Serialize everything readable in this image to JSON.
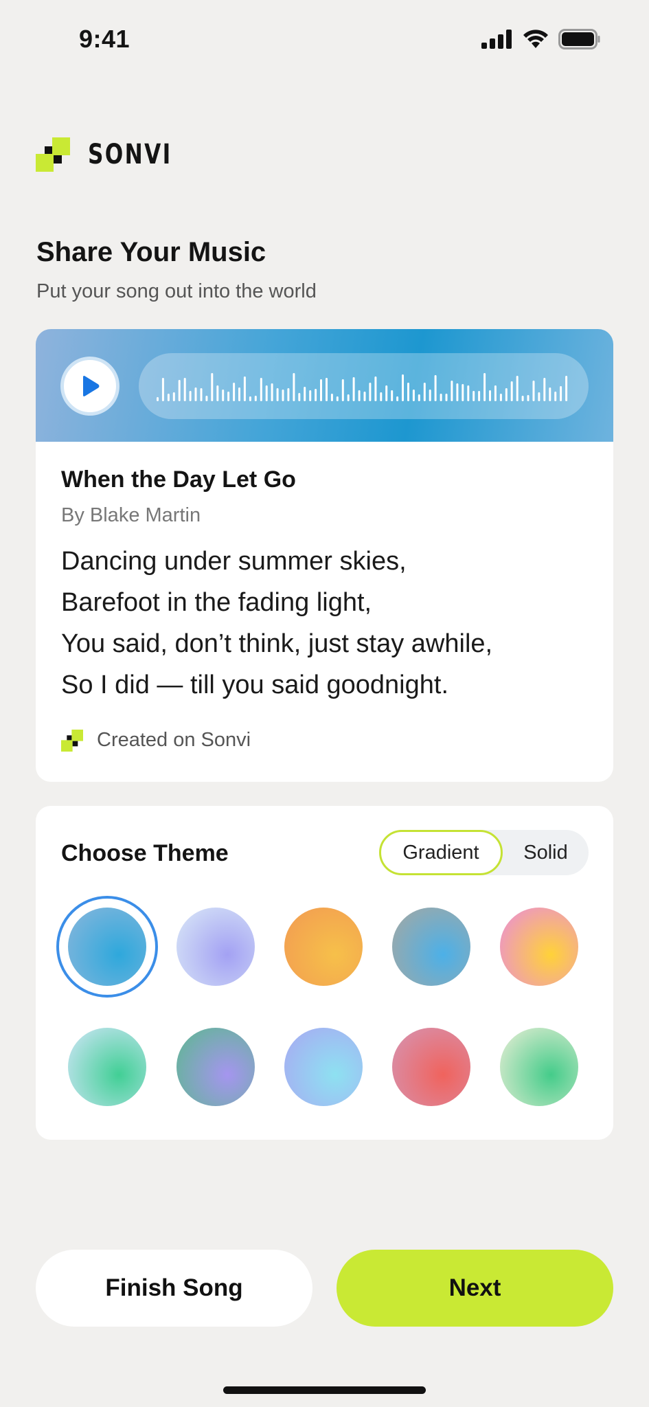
{
  "status_bar": {
    "time": "9:41"
  },
  "brand": {
    "name": "SONVI",
    "accent": "#c9e934"
  },
  "header": {
    "title": "Share Your Music",
    "subtitle": "Put your song out into the world"
  },
  "song": {
    "title": "When the Day Let Go",
    "artist": "By Blake Martin",
    "lyrics": [
      "Dancing under summer skies,",
      "Barefoot in the fading light,",
      "You said, don’t think, just stay awhile,",
      "So I did — till you said goodnight."
    ],
    "credit": "Created on Sonvi"
  },
  "theme": {
    "title": "Choose Theme",
    "toggle": {
      "options": [
        "Gradient",
        "Solid"
      ],
      "selected": "Gradient"
    },
    "selected_index": 0,
    "swatches": [
      {
        "name": "blue",
        "colors": [
          "#2ea8dc",
          "#8bb7dc"
        ]
      },
      {
        "name": "lavender",
        "colors": [
          "#a3a1f3",
          "#dbeaf7"
        ]
      },
      {
        "name": "orange",
        "colors": [
          "#f6c04a",
          "#f29a52"
        ]
      },
      {
        "name": "teal-blue",
        "colors": [
          "#4cb0e8",
          "#a8a8a0"
        ]
      },
      {
        "name": "rainbow",
        "colors": [
          "#ffd238",
          "#e98ae0"
        ]
      },
      {
        "name": "mint",
        "colors": [
          "#41cf95",
          "#d4e6fb"
        ]
      },
      {
        "name": "violet-green",
        "colors": [
          "#a595ef",
          "#5ab98c"
        ]
      },
      {
        "name": "aqua",
        "colors": [
          "#8ee1f1",
          "#a9a7f3"
        ]
      },
      {
        "name": "coral",
        "colors": [
          "#f0635d",
          "#d596b5"
        ]
      },
      {
        "name": "green-cream",
        "colors": [
          "#44cc8a",
          "#efefd8"
        ]
      }
    ]
  },
  "actions": {
    "finish_label": "Finish Song",
    "next_label": "Next"
  }
}
